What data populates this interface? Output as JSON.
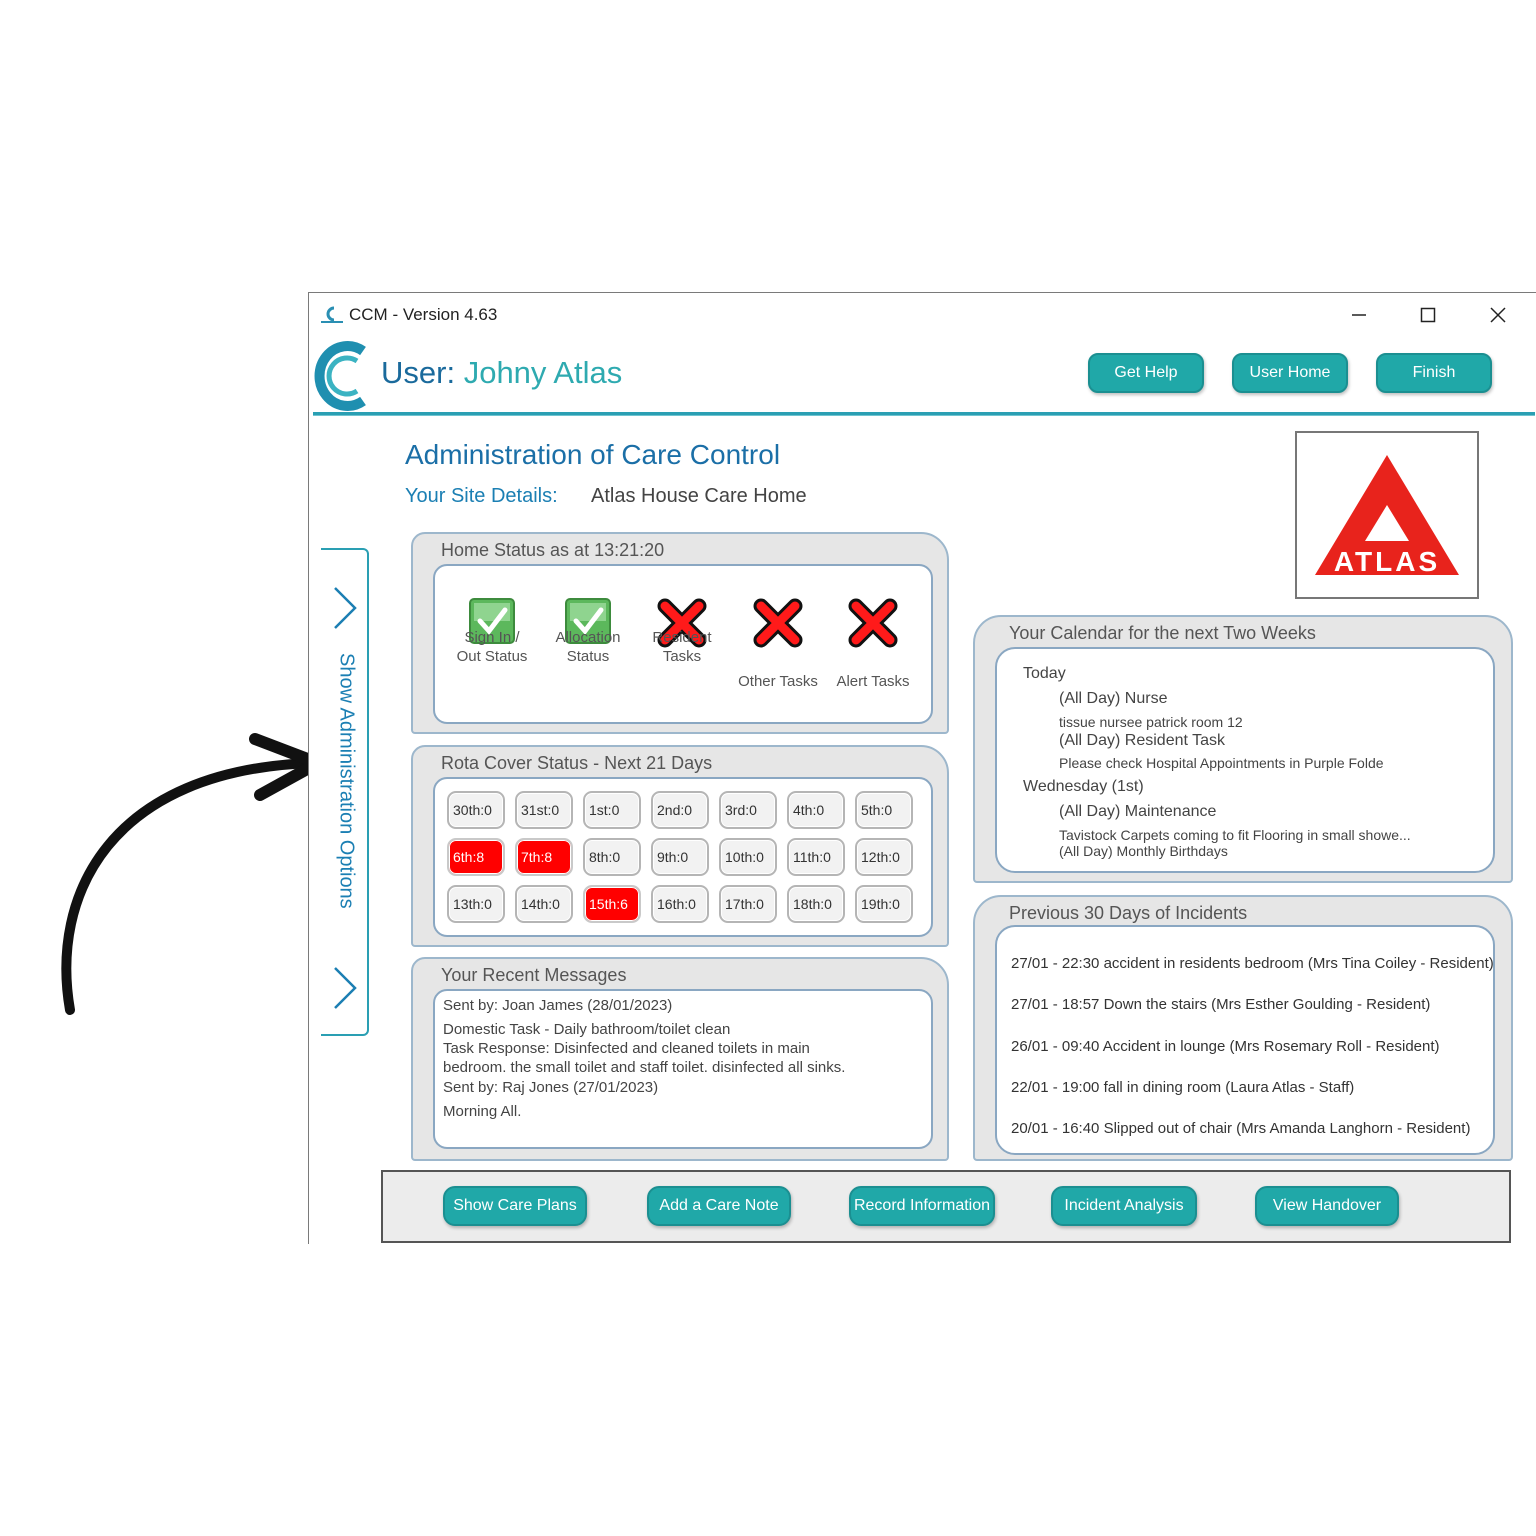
{
  "window": {
    "title": "CCM - Version 4.63",
    "controls": [
      "minimize-icon",
      "maximize-icon",
      "close-icon"
    ]
  },
  "header": {
    "user_label": "User:",
    "user_name": "Johny Atlas",
    "buttons": [
      "Get Help",
      "User Home",
      "Finish"
    ]
  },
  "page": {
    "title": "Administration of Care Control",
    "site_label": "Your Site Details:",
    "site_value": "Atlas House Care Home",
    "logo_text": "ATLAS"
  },
  "side_tab": {
    "label": "Show Administration Options"
  },
  "home_status": {
    "title": "Home Status as at 13:21:20",
    "items": [
      {
        "label_1": "Sign In /",
        "label_2": "Out Status",
        "state": "ok"
      },
      {
        "label_1": "Allocation",
        "label_2": "Status",
        "state": "ok"
      },
      {
        "label_1": "Resident",
        "label_2": "Tasks",
        "state": "alert"
      },
      {
        "label_1": "Other Tasks",
        "label_2": "",
        "state": "alert"
      },
      {
        "label_1": "Alert Tasks",
        "label_2": "",
        "state": "alert"
      }
    ]
  },
  "rota": {
    "title": "Rota Cover Status - Next 21 Days",
    "cells": [
      {
        "label": "30th:0",
        "alert": false
      },
      {
        "label": "31st:0",
        "alert": false
      },
      {
        "label": "1st:0",
        "alert": false
      },
      {
        "label": "2nd:0",
        "alert": false
      },
      {
        "label": "3rd:0",
        "alert": false
      },
      {
        "label": "4th:0",
        "alert": false
      },
      {
        "label": "5th:0",
        "alert": false
      },
      {
        "label": "6th:8",
        "alert": true
      },
      {
        "label": "7th:8",
        "alert": true
      },
      {
        "label": "8th:0",
        "alert": false
      },
      {
        "label": "9th:0",
        "alert": false
      },
      {
        "label": "10th:0",
        "alert": false
      },
      {
        "label": "11th:0",
        "alert": false
      },
      {
        "label": "12th:0",
        "alert": false
      },
      {
        "label": "13th:0",
        "alert": false
      },
      {
        "label": "14th:0",
        "alert": false
      },
      {
        "label": "15th:6",
        "alert": true
      },
      {
        "label": "16th:0",
        "alert": false
      },
      {
        "label": "17th:0",
        "alert": false
      },
      {
        "label": "18th:0",
        "alert": false
      },
      {
        "label": "19th:0",
        "alert": false
      }
    ]
  },
  "messages": {
    "title": "Your Recent Messages",
    "lines": [
      "Sent by: Joan James (28/01/2023)",
      "Domestic Task - Daily bathroom/toilet clean",
      "Task Response: Disinfected and cleaned toilets in main",
      "bedroom. the small toilet and staff toilet. disinfected all sinks.",
      "Sent by: Raj Jones (27/01/2023)",
      "Morning All."
    ]
  },
  "calendar": {
    "title": "Your Calendar for the next Two Weeks",
    "lines": [
      "Today",
      "(All Day) Nurse",
      "tissue nursee patrick room 12",
      "(All Day) Resident Task",
      "Please check Hospital Appointments in Purple Folde",
      "Wednesday (1st)",
      "(All Day) Maintenance",
      "Tavistock Carpets coming to fit Flooring in small showe...",
      "(All Day) Monthly Birthdays"
    ]
  },
  "incidents": {
    "title": "Previous 30 Days of Incidents",
    "lines": [
      "27/01 - 22:30 accident in residents bedroom (Mrs Tina Coiley - Resident)",
      "27/01 - 18:57 Down the stairs  (Mrs Esther Goulding - Resident)",
      "26/01 - 09:40 Accident in lounge (Mrs Rosemary Roll - Resident)",
      "22/01 - 19:00 fall in dining room (Laura Atlas - Staff)",
      "20/01 - 16:40 Slipped out of chair (Mrs Amanda Langhorn - Resident)"
    ]
  },
  "footer": {
    "buttons": [
      "Show Care Plans",
      "Add a Care Note",
      "Record Information",
      "Incident Analysis",
      "View Handover"
    ]
  },
  "colors": {
    "teal": "#20a8a8",
    "blue": "#1b6fa7",
    "alert_red": "#ff0000",
    "ok_green": "#4caf50"
  }
}
